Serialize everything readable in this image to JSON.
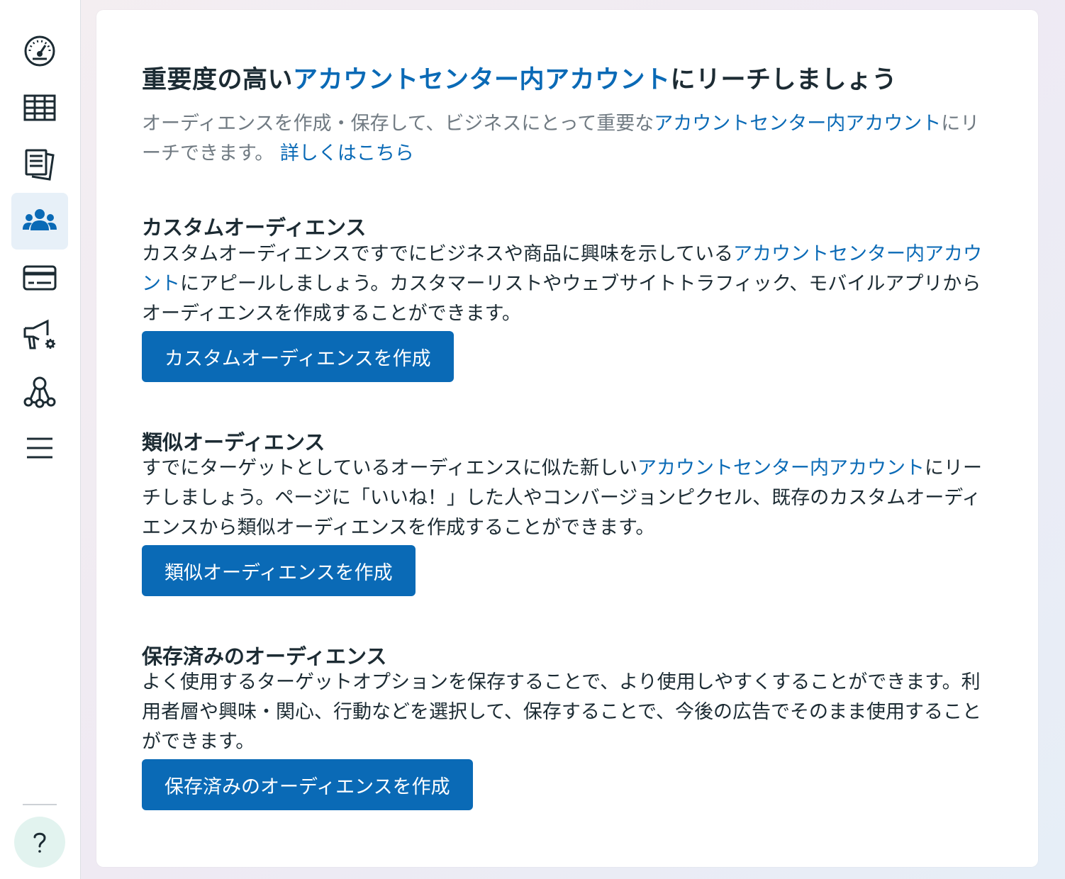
{
  "sidebar": {
    "items": [
      {
        "name": "dashboard",
        "icon": "speedometer-icon",
        "active": false
      },
      {
        "name": "table",
        "icon": "table-icon",
        "active": false
      },
      {
        "name": "pages",
        "icon": "documents-icon",
        "active": false
      },
      {
        "name": "audiences",
        "icon": "people-group-icon",
        "active": true
      },
      {
        "name": "billing",
        "icon": "credit-card-icon",
        "active": false
      },
      {
        "name": "ads-settings",
        "icon": "megaphone-gear-icon",
        "active": false
      },
      {
        "name": "network",
        "icon": "network-nodes-icon",
        "active": false
      },
      {
        "name": "menu",
        "icon": "hamburger-menu-icon",
        "active": false
      }
    ],
    "help_label": "?"
  },
  "colors": {
    "primary": "#0a6ab6",
    "active_nav_bg": "#e7f0f8",
    "text_dark": "#1c2b33",
    "text_muted": "#707a82"
  },
  "main": {
    "title_prefix": "重要度の高い",
    "title_link": "アカウントセンター内アカウント",
    "title_suffix": "にリーチしましょう",
    "intro_prefix": "オーディエンスを作成・保存して、ビジネスにとって重要な",
    "intro_link": "アカウントセンター内アカウント",
    "intro_suffix": "にリーチできます。",
    "learn_more": "詳しくはこちら",
    "sections": [
      {
        "title": "カスタムオーディエンス",
        "body_prefix": "カスタムオーディエンスですでにビジネスや商品に興味を示している",
        "body_link": "アカウントセンター内アカウント",
        "body_suffix": "にアピールしましょう。カスタマーリストやウェブサイトトラフィック、モバイルアプリからオーディエンスを作成することができます。",
        "button": "カスタムオーディエンスを作成"
      },
      {
        "title": "類似オーディエンス",
        "body_prefix": "すでにターゲットとしているオーディエンスに似た新しい",
        "body_link": "アカウントセンター内アカウント",
        "body_suffix": "にリーチしましょう。ページに「いいね！」した人やコンバージョンピクセル、既存のカスタムオーディエンスから類似オーディエンスを作成することができます。",
        "button": "類似オーディエンスを作成"
      },
      {
        "title": "保存済みのオーディエンス",
        "body": "よく使用するターゲットオプションを保存することで、より使用しやすくすることができます。利用者層や興味・関心、行動などを選択して、保存することで、今後の広告でそのまま使用することができます。",
        "button": "保存済みのオーディエンスを作成"
      }
    ]
  }
}
